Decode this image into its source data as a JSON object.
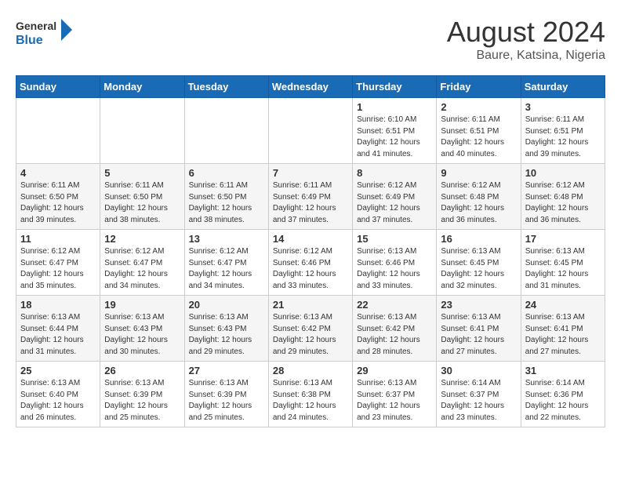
{
  "header": {
    "logo_line1": "General",
    "logo_line2": "Blue",
    "month_year": "August 2024",
    "location": "Baure, Katsina, Nigeria"
  },
  "weekdays": [
    "Sunday",
    "Monday",
    "Tuesday",
    "Wednesday",
    "Thursday",
    "Friday",
    "Saturday"
  ],
  "weeks": [
    [
      {
        "day": "",
        "info": ""
      },
      {
        "day": "",
        "info": ""
      },
      {
        "day": "",
        "info": ""
      },
      {
        "day": "",
        "info": ""
      },
      {
        "day": "1",
        "info": "Sunrise: 6:10 AM\nSunset: 6:51 PM\nDaylight: 12 hours\nand 41 minutes."
      },
      {
        "day": "2",
        "info": "Sunrise: 6:11 AM\nSunset: 6:51 PM\nDaylight: 12 hours\nand 40 minutes."
      },
      {
        "day": "3",
        "info": "Sunrise: 6:11 AM\nSunset: 6:51 PM\nDaylight: 12 hours\nand 39 minutes."
      }
    ],
    [
      {
        "day": "4",
        "info": "Sunrise: 6:11 AM\nSunset: 6:50 PM\nDaylight: 12 hours\nand 39 minutes."
      },
      {
        "day": "5",
        "info": "Sunrise: 6:11 AM\nSunset: 6:50 PM\nDaylight: 12 hours\nand 38 minutes."
      },
      {
        "day": "6",
        "info": "Sunrise: 6:11 AM\nSunset: 6:50 PM\nDaylight: 12 hours\nand 38 minutes."
      },
      {
        "day": "7",
        "info": "Sunrise: 6:11 AM\nSunset: 6:49 PM\nDaylight: 12 hours\nand 37 minutes."
      },
      {
        "day": "8",
        "info": "Sunrise: 6:12 AM\nSunset: 6:49 PM\nDaylight: 12 hours\nand 37 minutes."
      },
      {
        "day": "9",
        "info": "Sunrise: 6:12 AM\nSunset: 6:48 PM\nDaylight: 12 hours\nand 36 minutes."
      },
      {
        "day": "10",
        "info": "Sunrise: 6:12 AM\nSunset: 6:48 PM\nDaylight: 12 hours\nand 36 minutes."
      }
    ],
    [
      {
        "day": "11",
        "info": "Sunrise: 6:12 AM\nSunset: 6:47 PM\nDaylight: 12 hours\nand 35 minutes."
      },
      {
        "day": "12",
        "info": "Sunrise: 6:12 AM\nSunset: 6:47 PM\nDaylight: 12 hours\nand 34 minutes."
      },
      {
        "day": "13",
        "info": "Sunrise: 6:12 AM\nSunset: 6:47 PM\nDaylight: 12 hours\nand 34 minutes."
      },
      {
        "day": "14",
        "info": "Sunrise: 6:12 AM\nSunset: 6:46 PM\nDaylight: 12 hours\nand 33 minutes."
      },
      {
        "day": "15",
        "info": "Sunrise: 6:13 AM\nSunset: 6:46 PM\nDaylight: 12 hours\nand 33 minutes."
      },
      {
        "day": "16",
        "info": "Sunrise: 6:13 AM\nSunset: 6:45 PM\nDaylight: 12 hours\nand 32 minutes."
      },
      {
        "day": "17",
        "info": "Sunrise: 6:13 AM\nSunset: 6:45 PM\nDaylight: 12 hours\nand 31 minutes."
      }
    ],
    [
      {
        "day": "18",
        "info": "Sunrise: 6:13 AM\nSunset: 6:44 PM\nDaylight: 12 hours\nand 31 minutes."
      },
      {
        "day": "19",
        "info": "Sunrise: 6:13 AM\nSunset: 6:43 PM\nDaylight: 12 hours\nand 30 minutes."
      },
      {
        "day": "20",
        "info": "Sunrise: 6:13 AM\nSunset: 6:43 PM\nDaylight: 12 hours\nand 29 minutes."
      },
      {
        "day": "21",
        "info": "Sunrise: 6:13 AM\nSunset: 6:42 PM\nDaylight: 12 hours\nand 29 minutes."
      },
      {
        "day": "22",
        "info": "Sunrise: 6:13 AM\nSunset: 6:42 PM\nDaylight: 12 hours\nand 28 minutes."
      },
      {
        "day": "23",
        "info": "Sunrise: 6:13 AM\nSunset: 6:41 PM\nDaylight: 12 hours\nand 27 minutes."
      },
      {
        "day": "24",
        "info": "Sunrise: 6:13 AM\nSunset: 6:41 PM\nDaylight: 12 hours\nand 27 minutes."
      }
    ],
    [
      {
        "day": "25",
        "info": "Sunrise: 6:13 AM\nSunset: 6:40 PM\nDaylight: 12 hours\nand 26 minutes."
      },
      {
        "day": "26",
        "info": "Sunrise: 6:13 AM\nSunset: 6:39 PM\nDaylight: 12 hours\nand 25 minutes."
      },
      {
        "day": "27",
        "info": "Sunrise: 6:13 AM\nSunset: 6:39 PM\nDaylight: 12 hours\nand 25 minutes."
      },
      {
        "day": "28",
        "info": "Sunrise: 6:13 AM\nSunset: 6:38 PM\nDaylight: 12 hours\nand 24 minutes."
      },
      {
        "day": "29",
        "info": "Sunrise: 6:13 AM\nSunset: 6:37 PM\nDaylight: 12 hours\nand 23 minutes."
      },
      {
        "day": "30",
        "info": "Sunrise: 6:14 AM\nSunset: 6:37 PM\nDaylight: 12 hours\nand 23 minutes."
      },
      {
        "day": "31",
        "info": "Sunrise: 6:14 AM\nSunset: 6:36 PM\nDaylight: 12 hours\nand 22 minutes."
      }
    ]
  ]
}
